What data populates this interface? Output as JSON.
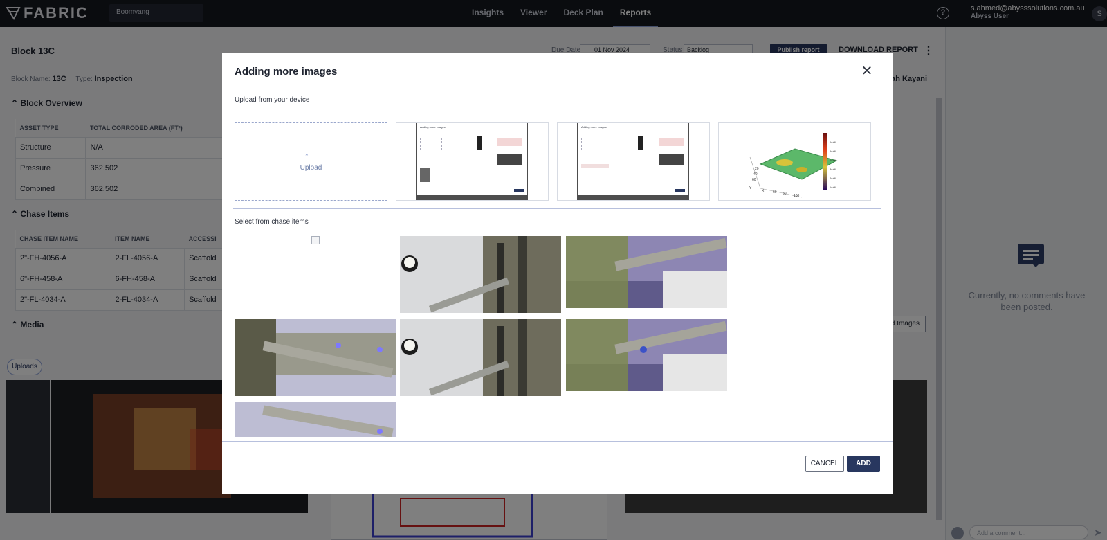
{
  "topbar": {
    "logo_text": "FABRIC",
    "site": "Boomvang",
    "tabs": [
      {
        "label": "Insights",
        "active": false
      },
      {
        "label": "Viewer",
        "active": false
      },
      {
        "label": "Deck Plan",
        "active": false
      },
      {
        "label": "Reports",
        "active": true
      }
    ],
    "user_email": "s.ahmed@abysssolutions.com.au",
    "user_role": "Abyss User",
    "user_initial": "S"
  },
  "report": {
    "title": "Block 13C",
    "due_label": "Due Date",
    "due_value": "01 Nov 2024",
    "status_label": "Status",
    "status_value": "Backlog",
    "publish_label": "Publish report",
    "download_label": "DOWNLOAD REPORT",
    "block_name_label": "Block Name:",
    "block_name": "13C",
    "type_label": "Type:",
    "type": "Inspection",
    "assignee_partial": "llah Kayani"
  },
  "block_overview": {
    "heading": "Block Overview",
    "columns": [
      "ASSET TYPE",
      "TOTAL CORRODED AREA (FT²)"
    ],
    "rows": [
      [
        "Structure",
        "N/A"
      ],
      [
        "Pressure",
        "362.502"
      ],
      [
        "Combined",
        "362.502"
      ]
    ]
  },
  "chase_items": {
    "heading": "Chase Items",
    "columns": [
      "CHASE ITEM NAME",
      "ITEM NAME",
      "ACCESSI"
    ],
    "rows": [
      [
        "2\"-FH-4056-A",
        "2-FL-4056-A",
        "Scaffold"
      ],
      [
        "6\"-FH-458-A",
        "6-FH-458-A",
        "Scaffold"
      ],
      [
        "2\"-FL-4034-A",
        "2-FL-4034-A",
        "Scaffold"
      ]
    ]
  },
  "media": {
    "heading": "Media",
    "uploads_label": "Uploads",
    "add_images_partial": "d Images"
  },
  "comments": {
    "empty_text": "Currently, no comments have been posted.",
    "input_placeholder": "Add a comment..."
  },
  "modal": {
    "title": "Adding more images",
    "upload_section_label": "Upload from your device",
    "upload_label": "Upload",
    "chase_section_label": "Select from chase items",
    "cancel_label": "CANCEL",
    "add_label": "ADD",
    "mini_title": "Adding more images",
    "colorbar_ticks": [
      "6e+6",
      "5e+6",
      "4e+6",
      "3e+6",
      "2e+6",
      "1e+6"
    ],
    "plot_axis_ticks_x": [
      "20",
      "40",
      "60",
      "80",
      "100"
    ],
    "plot_axis_ticks_y": [
      "20",
      "40",
      "60",
      "80",
      "100"
    ],
    "plot_axis_label_x": "X",
    "plot_axis_label_y": "Y"
  },
  "colors": {
    "nav_bg": "#15181f",
    "primary": "#28375f",
    "accent": "#8ea2d8"
  }
}
